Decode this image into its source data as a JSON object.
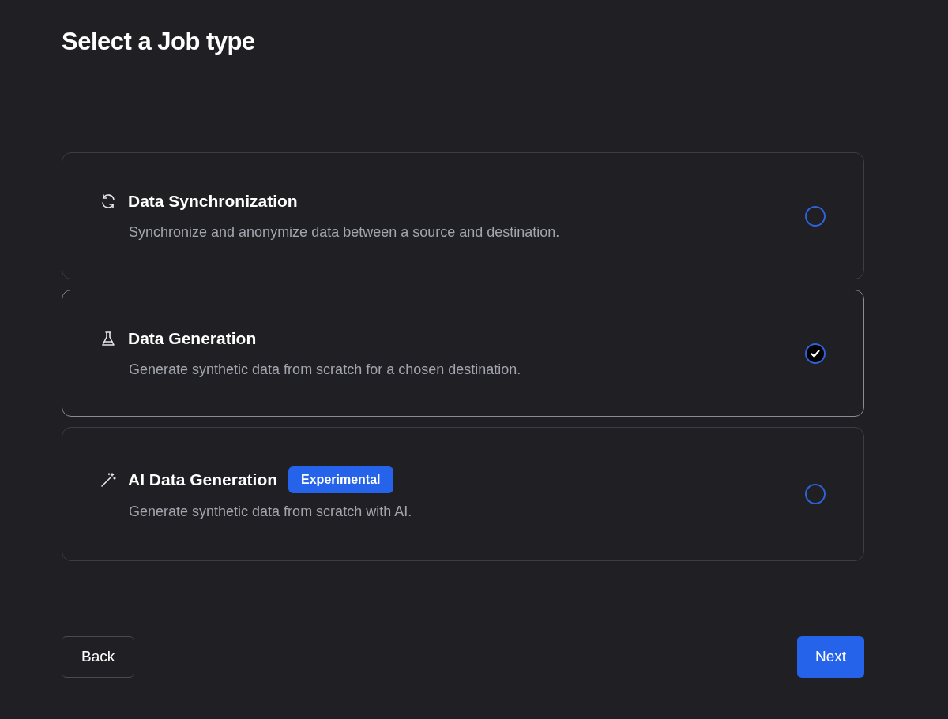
{
  "title": "Select a Job type",
  "options": [
    {
      "kind": "sync",
      "title": "Data Synchronization",
      "description": "Synchronize and anonymize data between a source and destination.",
      "selected": false
    },
    {
      "kind": "flask",
      "title": "Data Generation",
      "description": "Generate synthetic data from scratch for a chosen destination.",
      "selected": true
    },
    {
      "kind": "wand",
      "title": "AI Data Generation",
      "badge": "Experimental",
      "description": "Generate synthetic data from scratch with AI.",
      "selected": false
    }
  ],
  "back_button": "Back",
  "next_button": "Next"
}
